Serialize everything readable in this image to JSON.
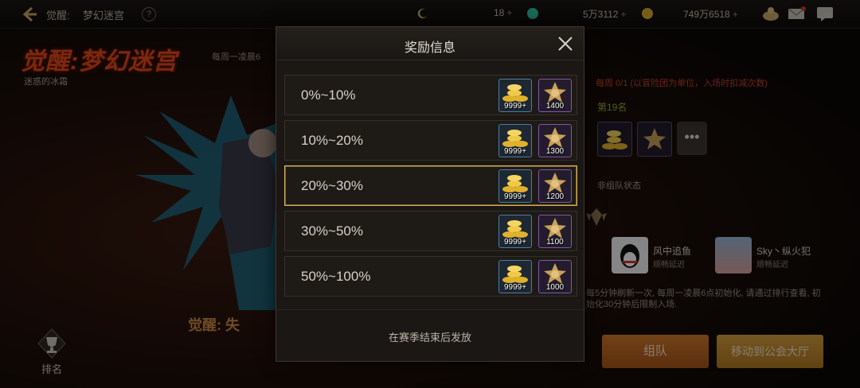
{
  "top_bar": {
    "title": "觉醒:",
    "subtitle": "梦幻迷宫",
    "help": "?",
    "resource_1": "18",
    "resource_2": "5万3112",
    "resource_3": "749万6518",
    "plus": "+"
  },
  "event": {
    "title": "觉醒:梦幻迷宫",
    "note": "每周一凌晨6",
    "sub": "迷惑的冰霜",
    "bottom_banner": "觉醒: 失"
  },
  "rank_button": {
    "label": "排名"
  },
  "side_panel": {
    "note": "每周 0/1 (以冒险团为单位，入场时扣减次数)",
    "rank": "第19名",
    "more": "•••",
    "team_state": "非组队状态",
    "members": [
      {
        "name": "风中追鱼",
        "sub": "顺畅延迟"
      },
      {
        "name": "Sky丶纵火犯",
        "sub": "顺畅延迟"
      }
    ],
    "info": "每5分钟刷新一次, 每周一凌晨6点初始化, 请通过排行查看, 初始化30分钟后限制入场.",
    "team_button": "组队",
    "hall_button": "移动到公会大厅"
  },
  "modal": {
    "title": "奖励信息",
    "footer": "在赛季结束后发放",
    "tiers": [
      {
        "range": "0%~10%",
        "gold_qty": "9999+",
        "star_qty": "1400",
        "selected": false
      },
      {
        "range": "10%~20%",
        "gold_qty": "9999+",
        "star_qty": "1300",
        "selected": false
      },
      {
        "range": "20%~30%",
        "gold_qty": "9999+",
        "star_qty": "1200",
        "selected": true
      },
      {
        "range": "30%~50%",
        "gold_qty": "9999+",
        "star_qty": "1100",
        "selected": false
      },
      {
        "range": "50%~100%",
        "gold_qty": "9999+",
        "star_qty": "1000",
        "selected": false
      }
    ]
  },
  "icons": {
    "back": "back-arrow-icon",
    "close": "close-icon",
    "gold": "gold-coins-icon",
    "star": "star-medal-icon",
    "trophy": "trophy-icon"
  },
  "colors": {
    "accent_gold": "#d7b25a",
    "title_red": "#e24a1c",
    "team_button": "#c06a24"
  }
}
